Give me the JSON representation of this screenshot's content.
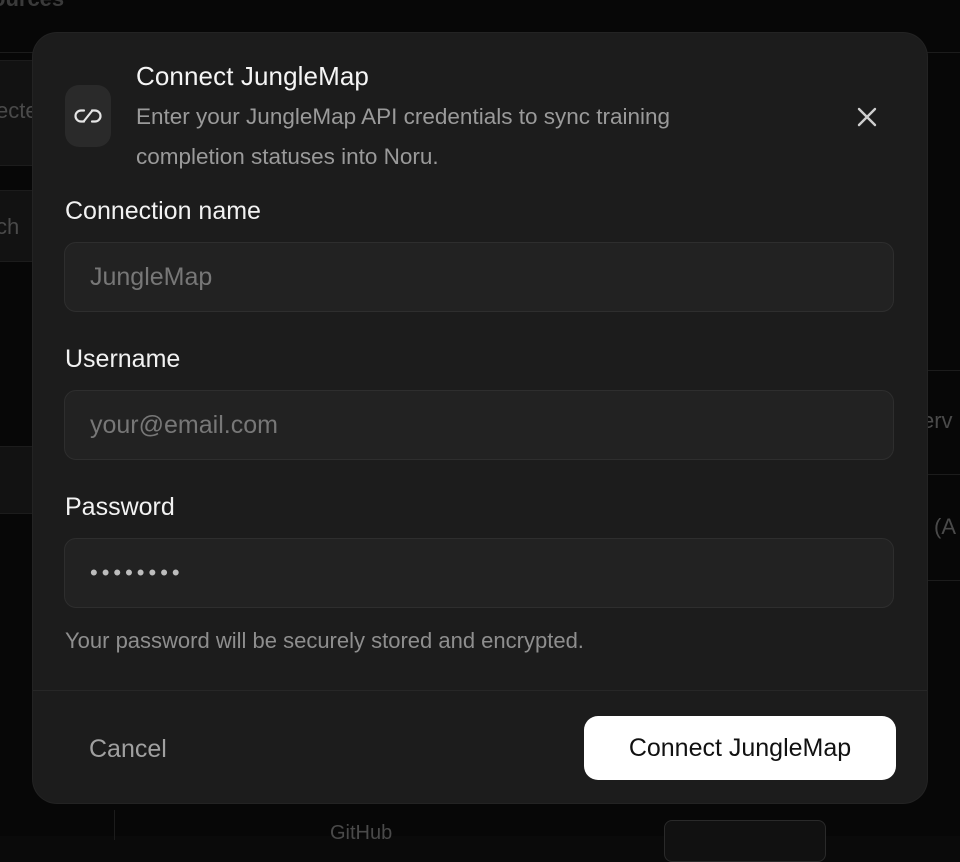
{
  "background": {
    "page_title": "ources",
    "fragments": [
      "ecte",
      "ch",
      "erv",
      "(A",
      "GitHub"
    ]
  },
  "modal": {
    "icon": "link-icon",
    "title": "Connect JungleMap",
    "subtitle": "Enter your JungleMap API credentials to sync training completion statuses into Noru.",
    "close_icon": "close-icon",
    "fields": {
      "connection_name": {
        "label": "Connection name",
        "value": "",
        "placeholder": "JungleMap"
      },
      "username": {
        "label": "Username",
        "value": "",
        "placeholder": "your@email.com"
      },
      "password": {
        "label": "Password",
        "value": "••••••••",
        "placeholder": ""
      }
    },
    "password_hint": "Your password will be securely stored and encrypted.",
    "cancel_label": "Cancel",
    "submit_label": "Connect JungleMap"
  }
}
